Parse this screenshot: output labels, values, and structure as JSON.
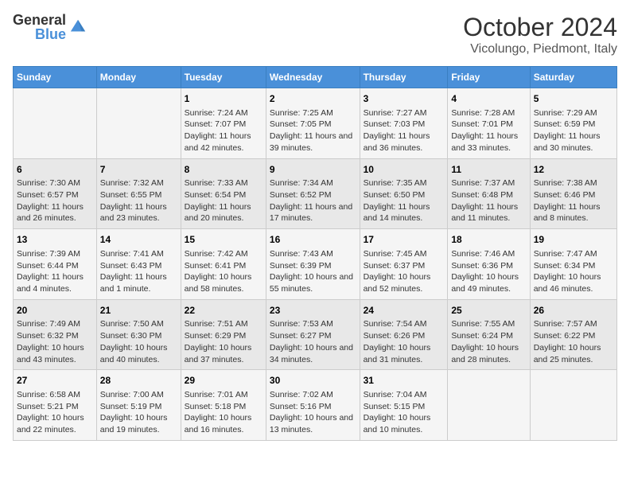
{
  "header": {
    "logo_general": "General",
    "logo_blue": "Blue",
    "month": "October 2024",
    "location": "Vicolungo, Piedmont, Italy"
  },
  "weekdays": [
    "Sunday",
    "Monday",
    "Tuesday",
    "Wednesday",
    "Thursday",
    "Friday",
    "Saturday"
  ],
  "weeks": [
    [
      {
        "day": "",
        "sunrise": "",
        "sunset": "",
        "daylight": ""
      },
      {
        "day": "",
        "sunrise": "",
        "sunset": "",
        "daylight": ""
      },
      {
        "day": "1",
        "sunrise": "Sunrise: 7:24 AM",
        "sunset": "Sunset: 7:07 PM",
        "daylight": "Daylight: 11 hours and 42 minutes."
      },
      {
        "day": "2",
        "sunrise": "Sunrise: 7:25 AM",
        "sunset": "Sunset: 7:05 PM",
        "daylight": "Daylight: 11 hours and 39 minutes."
      },
      {
        "day": "3",
        "sunrise": "Sunrise: 7:27 AM",
        "sunset": "Sunset: 7:03 PM",
        "daylight": "Daylight: 11 hours and 36 minutes."
      },
      {
        "day": "4",
        "sunrise": "Sunrise: 7:28 AM",
        "sunset": "Sunset: 7:01 PM",
        "daylight": "Daylight: 11 hours and 33 minutes."
      },
      {
        "day": "5",
        "sunrise": "Sunrise: 7:29 AM",
        "sunset": "Sunset: 6:59 PM",
        "daylight": "Daylight: 11 hours and 30 minutes."
      }
    ],
    [
      {
        "day": "6",
        "sunrise": "Sunrise: 7:30 AM",
        "sunset": "Sunset: 6:57 PM",
        "daylight": "Daylight: 11 hours and 26 minutes."
      },
      {
        "day": "7",
        "sunrise": "Sunrise: 7:32 AM",
        "sunset": "Sunset: 6:55 PM",
        "daylight": "Daylight: 11 hours and 23 minutes."
      },
      {
        "day": "8",
        "sunrise": "Sunrise: 7:33 AM",
        "sunset": "Sunset: 6:54 PM",
        "daylight": "Daylight: 11 hours and 20 minutes."
      },
      {
        "day": "9",
        "sunrise": "Sunrise: 7:34 AM",
        "sunset": "Sunset: 6:52 PM",
        "daylight": "Daylight: 11 hours and 17 minutes."
      },
      {
        "day": "10",
        "sunrise": "Sunrise: 7:35 AM",
        "sunset": "Sunset: 6:50 PM",
        "daylight": "Daylight: 11 hours and 14 minutes."
      },
      {
        "day": "11",
        "sunrise": "Sunrise: 7:37 AM",
        "sunset": "Sunset: 6:48 PM",
        "daylight": "Daylight: 11 hours and 11 minutes."
      },
      {
        "day": "12",
        "sunrise": "Sunrise: 7:38 AM",
        "sunset": "Sunset: 6:46 PM",
        "daylight": "Daylight: 11 hours and 8 minutes."
      }
    ],
    [
      {
        "day": "13",
        "sunrise": "Sunrise: 7:39 AM",
        "sunset": "Sunset: 6:44 PM",
        "daylight": "Daylight: 11 hours and 4 minutes."
      },
      {
        "day": "14",
        "sunrise": "Sunrise: 7:41 AM",
        "sunset": "Sunset: 6:43 PM",
        "daylight": "Daylight: 11 hours and 1 minute."
      },
      {
        "day": "15",
        "sunrise": "Sunrise: 7:42 AM",
        "sunset": "Sunset: 6:41 PM",
        "daylight": "Daylight: 10 hours and 58 minutes."
      },
      {
        "day": "16",
        "sunrise": "Sunrise: 7:43 AM",
        "sunset": "Sunset: 6:39 PM",
        "daylight": "Daylight: 10 hours and 55 minutes."
      },
      {
        "day": "17",
        "sunrise": "Sunrise: 7:45 AM",
        "sunset": "Sunset: 6:37 PM",
        "daylight": "Daylight: 10 hours and 52 minutes."
      },
      {
        "day": "18",
        "sunrise": "Sunrise: 7:46 AM",
        "sunset": "Sunset: 6:36 PM",
        "daylight": "Daylight: 10 hours and 49 minutes."
      },
      {
        "day": "19",
        "sunrise": "Sunrise: 7:47 AM",
        "sunset": "Sunset: 6:34 PM",
        "daylight": "Daylight: 10 hours and 46 minutes."
      }
    ],
    [
      {
        "day": "20",
        "sunrise": "Sunrise: 7:49 AM",
        "sunset": "Sunset: 6:32 PM",
        "daylight": "Daylight: 10 hours and 43 minutes."
      },
      {
        "day": "21",
        "sunrise": "Sunrise: 7:50 AM",
        "sunset": "Sunset: 6:30 PM",
        "daylight": "Daylight: 10 hours and 40 minutes."
      },
      {
        "day": "22",
        "sunrise": "Sunrise: 7:51 AM",
        "sunset": "Sunset: 6:29 PM",
        "daylight": "Daylight: 10 hours and 37 minutes."
      },
      {
        "day": "23",
        "sunrise": "Sunrise: 7:53 AM",
        "sunset": "Sunset: 6:27 PM",
        "daylight": "Daylight: 10 hours and 34 minutes."
      },
      {
        "day": "24",
        "sunrise": "Sunrise: 7:54 AM",
        "sunset": "Sunset: 6:26 PM",
        "daylight": "Daylight: 10 hours and 31 minutes."
      },
      {
        "day": "25",
        "sunrise": "Sunrise: 7:55 AM",
        "sunset": "Sunset: 6:24 PM",
        "daylight": "Daylight: 10 hours and 28 minutes."
      },
      {
        "day": "26",
        "sunrise": "Sunrise: 7:57 AM",
        "sunset": "Sunset: 6:22 PM",
        "daylight": "Daylight: 10 hours and 25 minutes."
      }
    ],
    [
      {
        "day": "27",
        "sunrise": "Sunrise: 6:58 AM",
        "sunset": "Sunset: 5:21 PM",
        "daylight": "Daylight: 10 hours and 22 minutes."
      },
      {
        "day": "28",
        "sunrise": "Sunrise: 7:00 AM",
        "sunset": "Sunset: 5:19 PM",
        "daylight": "Daylight: 10 hours and 19 minutes."
      },
      {
        "day": "29",
        "sunrise": "Sunrise: 7:01 AM",
        "sunset": "Sunset: 5:18 PM",
        "daylight": "Daylight: 10 hours and 16 minutes."
      },
      {
        "day": "30",
        "sunrise": "Sunrise: 7:02 AM",
        "sunset": "Sunset: 5:16 PM",
        "daylight": "Daylight: 10 hours and 13 minutes."
      },
      {
        "day": "31",
        "sunrise": "Sunrise: 7:04 AM",
        "sunset": "Sunset: 5:15 PM",
        "daylight": "Daylight: 10 hours and 10 minutes."
      },
      {
        "day": "",
        "sunrise": "",
        "sunset": "",
        "daylight": ""
      },
      {
        "day": "",
        "sunrise": "",
        "sunset": "",
        "daylight": ""
      }
    ]
  ]
}
